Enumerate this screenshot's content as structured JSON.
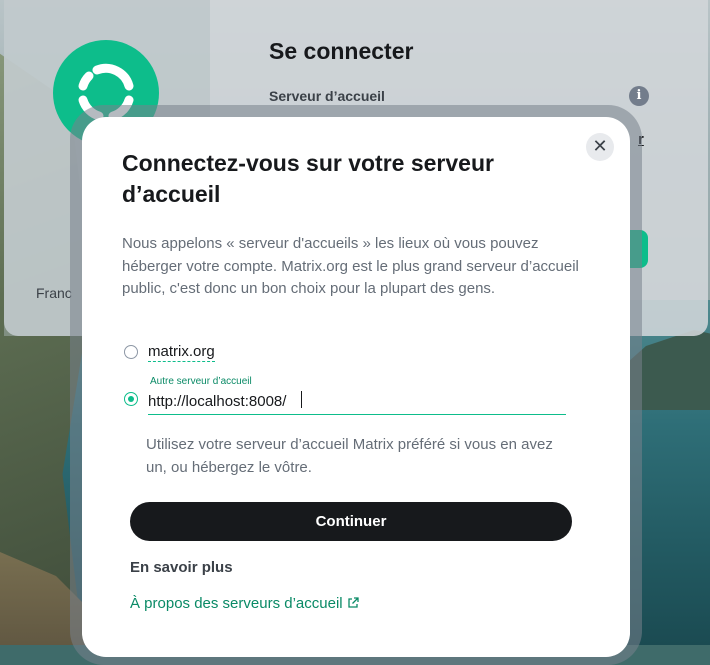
{
  "colors": {
    "accent": "#0dbd8b",
    "text_primary": "#17191c",
    "text_secondary": "#656d77",
    "link": "#0a8a66",
    "button_bg": "#17191c"
  },
  "background_page": {
    "title": "Se connecter",
    "homeserver_label": "Serveur d’accueil",
    "language": "Franc",
    "info_icon": "info-icon",
    "peek_link": "r"
  },
  "dialog": {
    "title": "Connectez-vous sur votre serveur d’accueil",
    "description": "Nous appelons « serveur d'accueils » les lieux où vous pouvez héberger votre compte. Matrix.org est le plus grand serveur d’accueil public, c'est donc un bon choix pour la plupart des gens.",
    "close_icon": "close-icon",
    "options": {
      "matrix_org_label": "matrix.org",
      "other_label": "Autre serveur d’accueil",
      "other_value": "http://localhost:8008/",
      "selected": "other"
    },
    "hint": "Utilisez votre serveur d’accueil Matrix préféré si vous en avez un, ou hébergez le vôtre.",
    "continue_label": "Continuer",
    "learn_more_heading": "En savoir plus",
    "about_link": "À propos des serveurs d’accueil",
    "external_icon": "external-link-icon"
  }
}
